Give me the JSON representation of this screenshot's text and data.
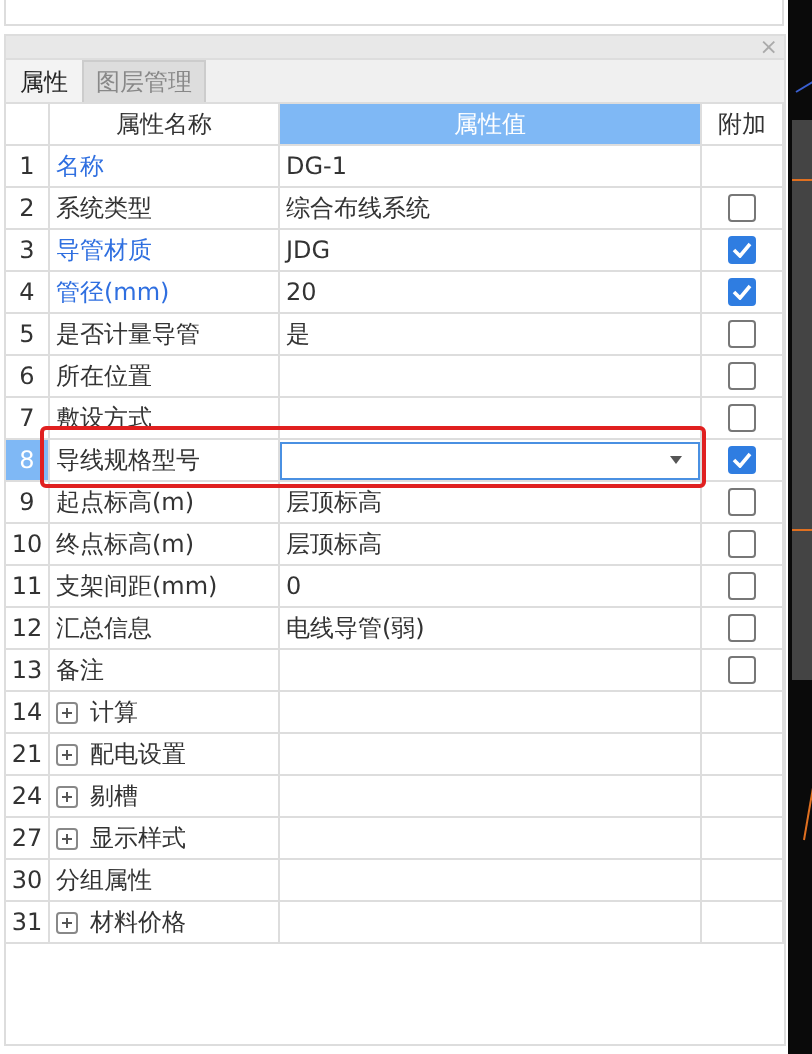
{
  "panel": {
    "close_icon": "×"
  },
  "tabs": [
    {
      "label": "属性",
      "selected": true
    },
    {
      "label": "图层管理",
      "selected": false
    }
  ],
  "table": {
    "columns": [
      {
        "label": "属性名称",
        "selected": false
      },
      {
        "label": "属性值",
        "selected": true
      },
      {
        "label": "附加",
        "selected": false
      }
    ],
    "rows": [
      {
        "num": "1",
        "name": "名称",
        "value": "DG-1",
        "kind": "field",
        "highlighted": true,
        "selected": false
      },
      {
        "num": "2",
        "name": "系统类型",
        "value": "综合布线系统",
        "kind": "field",
        "highlighted": false,
        "checked": false,
        "selected": false
      },
      {
        "num": "3",
        "name": "导管材质",
        "value": "JDG",
        "kind": "field",
        "highlighted": true,
        "checked": true,
        "selected": false
      },
      {
        "num": "4",
        "name": "管径(mm)",
        "value": "20",
        "kind": "field",
        "highlighted": true,
        "checked": true,
        "selected": false
      },
      {
        "num": "5",
        "name": "是否计量导管",
        "value": "是",
        "kind": "field",
        "highlighted": false,
        "checked": false,
        "selected": false
      },
      {
        "num": "6",
        "name": "所在位置",
        "kind": "field",
        "highlighted": false,
        "checked": false,
        "selected": false
      },
      {
        "num": "7",
        "name": "敷设方式",
        "kind": "field",
        "highlighted": false,
        "checked": false,
        "selected": false
      },
      {
        "num": "8",
        "name": "导线规格型号",
        "kind": "dropdown",
        "highlighted": false,
        "checked": true,
        "selected": true
      },
      {
        "num": "9",
        "name": "起点标高(m)",
        "value": "层顶标高",
        "kind": "field",
        "highlighted": false,
        "checked": false,
        "selected": false
      },
      {
        "num": "10",
        "name": "终点标高(m)",
        "value": "层顶标高",
        "kind": "field",
        "highlighted": false,
        "checked": false,
        "selected": false
      },
      {
        "num": "11",
        "name": "支架间距(mm)",
        "value": "0",
        "kind": "field",
        "highlighted": false,
        "checked": false,
        "selected": false
      },
      {
        "num": "12",
        "name": "汇总信息",
        "value": "电线导管(弱)",
        "kind": "field",
        "highlighted": false,
        "checked": false,
        "selected": false
      },
      {
        "num": "13",
        "name": "备注",
        "kind": "field",
        "highlighted": false,
        "checked": false,
        "selected": false
      },
      {
        "num": "14",
        "name": "计算",
        "kind": "group",
        "selected": false
      },
      {
        "num": "21",
        "name": "配电设置",
        "kind": "group",
        "selected": false
      },
      {
        "num": "24",
        "name": "剔槽",
        "kind": "group",
        "selected": false
      },
      {
        "num": "27",
        "name": "显示样式",
        "kind": "group",
        "selected": false
      },
      {
        "num": "30",
        "name": "分组属性",
        "kind": "field",
        "highlighted": false,
        "selected": false
      },
      {
        "num": "31",
        "name": "材料价格",
        "kind": "group",
        "selected": false
      }
    ]
  }
}
